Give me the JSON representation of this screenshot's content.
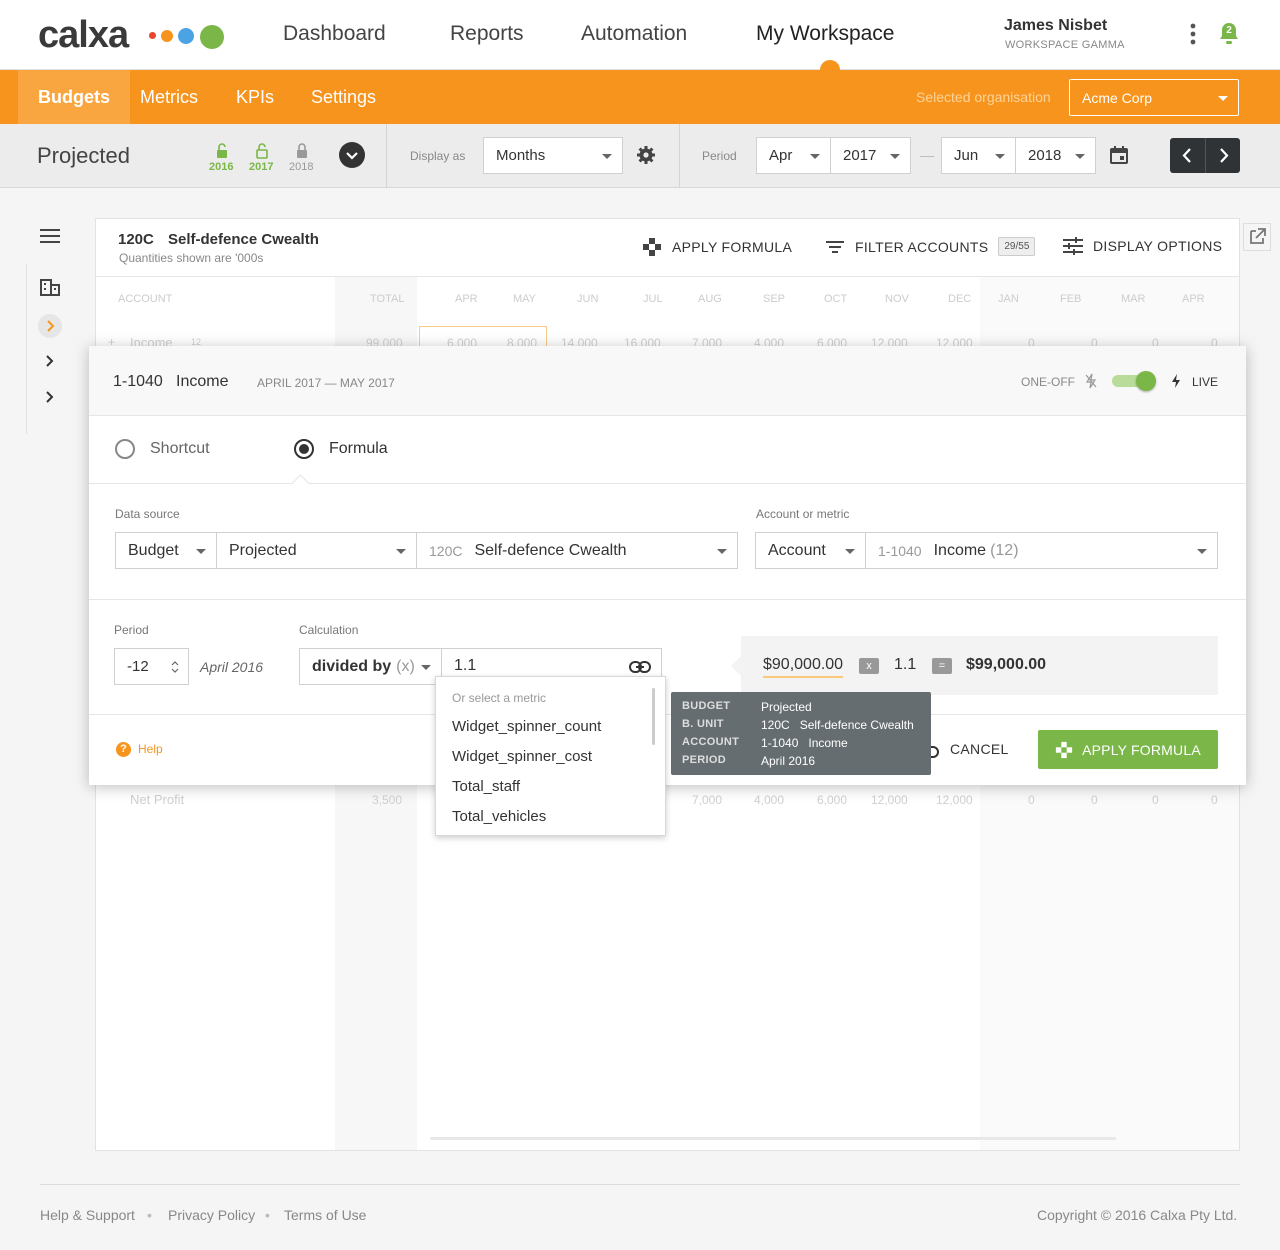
{
  "brand": {
    "name": "calxa",
    "accent": "#f7941d",
    "green": "#7ab648",
    "dots": [
      "#e8462f",
      "#f7941d",
      "#4ba3e3",
      "#7ab648"
    ]
  },
  "nav": {
    "items": [
      "Dashboard",
      "Reports",
      "Automation",
      "My Workspace"
    ],
    "active": "My Workspace"
  },
  "user": {
    "name": "James Nisbet",
    "workspace": "WORKSPACE GAMMA",
    "notifications": "2"
  },
  "subnav": {
    "tabs": [
      "Budgets",
      "Metrics",
      "KPIs",
      "Settings"
    ],
    "active": "Budgets",
    "org_label": "Selected organisation",
    "org_value": "Acme Corp"
  },
  "toolbar": {
    "title": "Projected",
    "years": [
      {
        "label": "2016",
        "state": "unlocked"
      },
      {
        "label": "2017",
        "state": "unlocked"
      },
      {
        "label": "2018",
        "state": "locked"
      }
    ],
    "display_as_label": "Display as",
    "display_as_value": "Months",
    "period_label": "Period",
    "period_from_month": "Apr",
    "period_from_year": "2017",
    "period_dash": "—",
    "period_to_month": "Jun",
    "period_to_year": "2018"
  },
  "card": {
    "code": "120C",
    "name": "Self-defence Cwealth",
    "subtitle": "Quantities shown are '000s",
    "apply_formula": "APPLY FORMULA",
    "filter_accounts": "FILTER ACCOUNTS",
    "filter_count": "29/55",
    "display_options": "DISPLAY OPTIONS"
  },
  "table": {
    "headers": [
      "ACCOUNT",
      "TOTAL",
      "APR",
      "MAY",
      "JUN",
      "JUL",
      "AUG",
      "SEP",
      "OCT",
      "NOV",
      "DEC",
      "JAN",
      "FEB",
      "MAR",
      "APR"
    ],
    "income_row": {
      "label": "Income",
      "count": "12",
      "values": [
        "99,000",
        "6,000",
        "8,000",
        "14,000",
        "16,000",
        "7,000",
        "4,000",
        "6,000",
        "12,000",
        "12,000",
        "0",
        "0",
        "0",
        "0"
      ]
    },
    "net_profit_row": {
      "label": "Net Profit",
      "values": [
        "3,500",
        "7,000",
        "4,000",
        "6,000",
        "12,000",
        "12,000",
        "0",
        "0",
        "0",
        "0"
      ]
    }
  },
  "modal": {
    "code": "1-1040",
    "name": "Income",
    "range": "APRIL 2017 — MAY 2017",
    "one_off": "ONE-OFF",
    "live": "LIVE",
    "mode_shortcut": "Shortcut",
    "mode_formula": "Formula",
    "data_source_label": "Data source",
    "ds_type": "Budget",
    "ds_budget": "Projected",
    "ds_unit_code": "120C",
    "ds_unit_name": "Self-defence Cwealth",
    "account_label": "Account or metric",
    "acc_type": "Account",
    "acc_code": "1-1040",
    "acc_name": "Income",
    "acc_count": "(12)",
    "period_label": "Period",
    "period_value": "-12",
    "period_text": "April 2016",
    "calc_label": "Calculation",
    "calc_op": "divided by",
    "calc_op_sym": "(x)",
    "calc_value": "1.1",
    "result_base": "$90,000.00",
    "result_op": "x",
    "result_factor": "1.1",
    "result_eq": "=",
    "result_total": "$99,000.00",
    "help": "Help",
    "cancel": "CANCEL",
    "apply": "APPLY FORMULA"
  },
  "dropdown": {
    "header": "Or select a metric",
    "items": [
      "Widget_spinner_count",
      "Widget_spinner_cost",
      "Total_staff",
      "Total_vehicles"
    ]
  },
  "tooltip": {
    "rows": [
      {
        "k": "BUDGET",
        "v": "Projected"
      },
      {
        "k": "B. UNIT",
        "v": "120C   Self-defence Cwealth"
      },
      {
        "k": "ACCOUNT",
        "v": "1-1040   Income"
      },
      {
        "k": "PERIOD",
        "v": "April 2016"
      }
    ]
  },
  "footer": {
    "links": [
      "Help & Support",
      "Privacy Policy",
      "Terms of Use"
    ],
    "copyright": "Copyright © 2016 Calxa Pty Ltd."
  }
}
